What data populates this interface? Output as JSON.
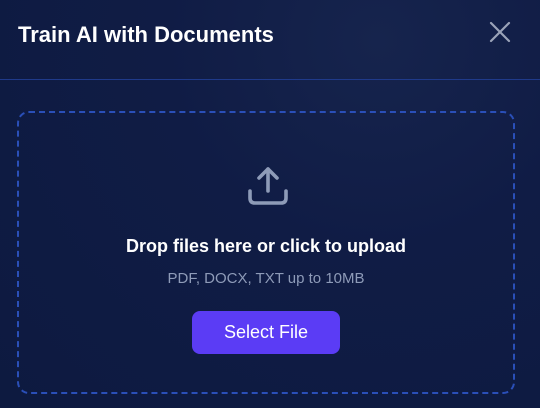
{
  "dialog": {
    "title": "Train AI with Documents",
    "close_icon": "close-icon"
  },
  "dropzone": {
    "icon": "upload-icon",
    "primary_text": "Drop files here or click to upload",
    "hint_text": "PDF, DOCX, TXT up to 10MB",
    "button_label": "Select File"
  },
  "colors": {
    "background": "#0d1a40",
    "accent_button": "#5b3cf5",
    "dashed_border": "#2a4fb8",
    "icon": "#8e9bb8",
    "hint_text": "#8e9bb8"
  }
}
